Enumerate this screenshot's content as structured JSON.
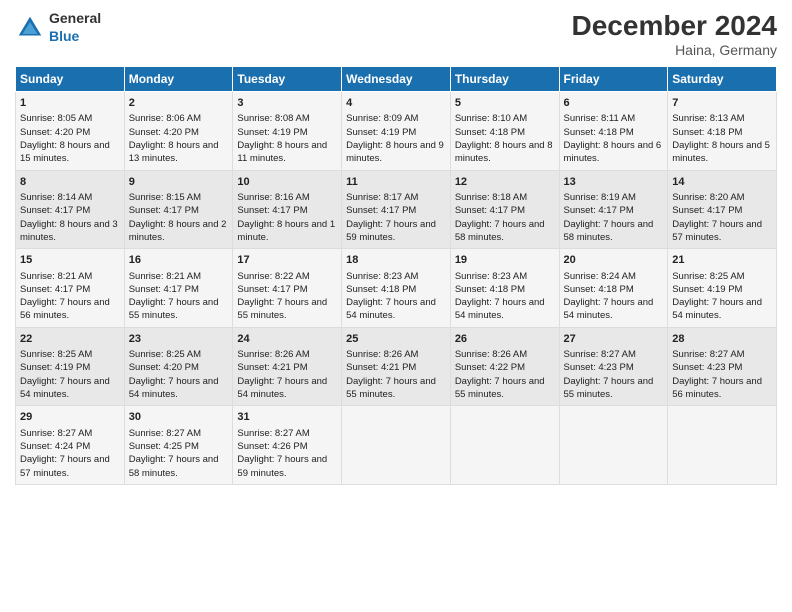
{
  "header": {
    "logo_general": "General",
    "logo_blue": "Blue",
    "title": "December 2024",
    "subtitle": "Haina, Germany"
  },
  "calendar": {
    "days": [
      "Sunday",
      "Monday",
      "Tuesday",
      "Wednesday",
      "Thursday",
      "Friday",
      "Saturday"
    ],
    "weeks": [
      [
        {
          "num": "1",
          "sunrise": "Sunrise: 8:05 AM",
          "sunset": "Sunset: 4:20 PM",
          "daylight": "Daylight: 8 hours and 15 minutes."
        },
        {
          "num": "2",
          "sunrise": "Sunrise: 8:06 AM",
          "sunset": "Sunset: 4:20 PM",
          "daylight": "Daylight: 8 hours and 13 minutes."
        },
        {
          "num": "3",
          "sunrise": "Sunrise: 8:08 AM",
          "sunset": "Sunset: 4:19 PM",
          "daylight": "Daylight: 8 hours and 11 minutes."
        },
        {
          "num": "4",
          "sunrise": "Sunrise: 8:09 AM",
          "sunset": "Sunset: 4:19 PM",
          "daylight": "Daylight: 8 hours and 9 minutes."
        },
        {
          "num": "5",
          "sunrise": "Sunrise: 8:10 AM",
          "sunset": "Sunset: 4:18 PM",
          "daylight": "Daylight: 8 hours and 8 minutes."
        },
        {
          "num": "6",
          "sunrise": "Sunrise: 8:11 AM",
          "sunset": "Sunset: 4:18 PM",
          "daylight": "Daylight: 8 hours and 6 minutes."
        },
        {
          "num": "7",
          "sunrise": "Sunrise: 8:13 AM",
          "sunset": "Sunset: 4:18 PM",
          "daylight": "Daylight: 8 hours and 5 minutes."
        }
      ],
      [
        {
          "num": "8",
          "sunrise": "Sunrise: 8:14 AM",
          "sunset": "Sunset: 4:17 PM",
          "daylight": "Daylight: 8 hours and 3 minutes."
        },
        {
          "num": "9",
          "sunrise": "Sunrise: 8:15 AM",
          "sunset": "Sunset: 4:17 PM",
          "daylight": "Daylight: 8 hours and 2 minutes."
        },
        {
          "num": "10",
          "sunrise": "Sunrise: 8:16 AM",
          "sunset": "Sunset: 4:17 PM",
          "daylight": "Daylight: 8 hours and 1 minute."
        },
        {
          "num": "11",
          "sunrise": "Sunrise: 8:17 AM",
          "sunset": "Sunset: 4:17 PM",
          "daylight": "Daylight: 7 hours and 59 minutes."
        },
        {
          "num": "12",
          "sunrise": "Sunrise: 8:18 AM",
          "sunset": "Sunset: 4:17 PM",
          "daylight": "Daylight: 7 hours and 58 minutes."
        },
        {
          "num": "13",
          "sunrise": "Sunrise: 8:19 AM",
          "sunset": "Sunset: 4:17 PM",
          "daylight": "Daylight: 7 hours and 58 minutes."
        },
        {
          "num": "14",
          "sunrise": "Sunrise: 8:20 AM",
          "sunset": "Sunset: 4:17 PM",
          "daylight": "Daylight: 7 hours and 57 minutes."
        }
      ],
      [
        {
          "num": "15",
          "sunrise": "Sunrise: 8:21 AM",
          "sunset": "Sunset: 4:17 PM",
          "daylight": "Daylight: 7 hours and 56 minutes."
        },
        {
          "num": "16",
          "sunrise": "Sunrise: 8:21 AM",
          "sunset": "Sunset: 4:17 PM",
          "daylight": "Daylight: 7 hours and 55 minutes."
        },
        {
          "num": "17",
          "sunrise": "Sunrise: 8:22 AM",
          "sunset": "Sunset: 4:17 PM",
          "daylight": "Daylight: 7 hours and 55 minutes."
        },
        {
          "num": "18",
          "sunrise": "Sunrise: 8:23 AM",
          "sunset": "Sunset: 4:18 PM",
          "daylight": "Daylight: 7 hours and 54 minutes."
        },
        {
          "num": "19",
          "sunrise": "Sunrise: 8:23 AM",
          "sunset": "Sunset: 4:18 PM",
          "daylight": "Daylight: 7 hours and 54 minutes."
        },
        {
          "num": "20",
          "sunrise": "Sunrise: 8:24 AM",
          "sunset": "Sunset: 4:18 PM",
          "daylight": "Daylight: 7 hours and 54 minutes."
        },
        {
          "num": "21",
          "sunrise": "Sunrise: 8:25 AM",
          "sunset": "Sunset: 4:19 PM",
          "daylight": "Daylight: 7 hours and 54 minutes."
        }
      ],
      [
        {
          "num": "22",
          "sunrise": "Sunrise: 8:25 AM",
          "sunset": "Sunset: 4:19 PM",
          "daylight": "Daylight: 7 hours and 54 minutes."
        },
        {
          "num": "23",
          "sunrise": "Sunrise: 8:25 AM",
          "sunset": "Sunset: 4:20 PM",
          "daylight": "Daylight: 7 hours and 54 minutes."
        },
        {
          "num": "24",
          "sunrise": "Sunrise: 8:26 AM",
          "sunset": "Sunset: 4:21 PM",
          "daylight": "Daylight: 7 hours and 54 minutes."
        },
        {
          "num": "25",
          "sunrise": "Sunrise: 8:26 AM",
          "sunset": "Sunset: 4:21 PM",
          "daylight": "Daylight: 7 hours and 55 minutes."
        },
        {
          "num": "26",
          "sunrise": "Sunrise: 8:26 AM",
          "sunset": "Sunset: 4:22 PM",
          "daylight": "Daylight: 7 hours and 55 minutes."
        },
        {
          "num": "27",
          "sunrise": "Sunrise: 8:27 AM",
          "sunset": "Sunset: 4:23 PM",
          "daylight": "Daylight: 7 hours and 55 minutes."
        },
        {
          "num": "28",
          "sunrise": "Sunrise: 8:27 AM",
          "sunset": "Sunset: 4:23 PM",
          "daylight": "Daylight: 7 hours and 56 minutes."
        }
      ],
      [
        {
          "num": "29",
          "sunrise": "Sunrise: 8:27 AM",
          "sunset": "Sunset: 4:24 PM",
          "daylight": "Daylight: 7 hours and 57 minutes."
        },
        {
          "num": "30",
          "sunrise": "Sunrise: 8:27 AM",
          "sunset": "Sunset: 4:25 PM",
          "daylight": "Daylight: 7 hours and 58 minutes."
        },
        {
          "num": "31",
          "sunrise": "Sunrise: 8:27 AM",
          "sunset": "Sunset: 4:26 PM",
          "daylight": "Daylight: 7 hours and 59 minutes."
        },
        null,
        null,
        null,
        null
      ]
    ]
  }
}
